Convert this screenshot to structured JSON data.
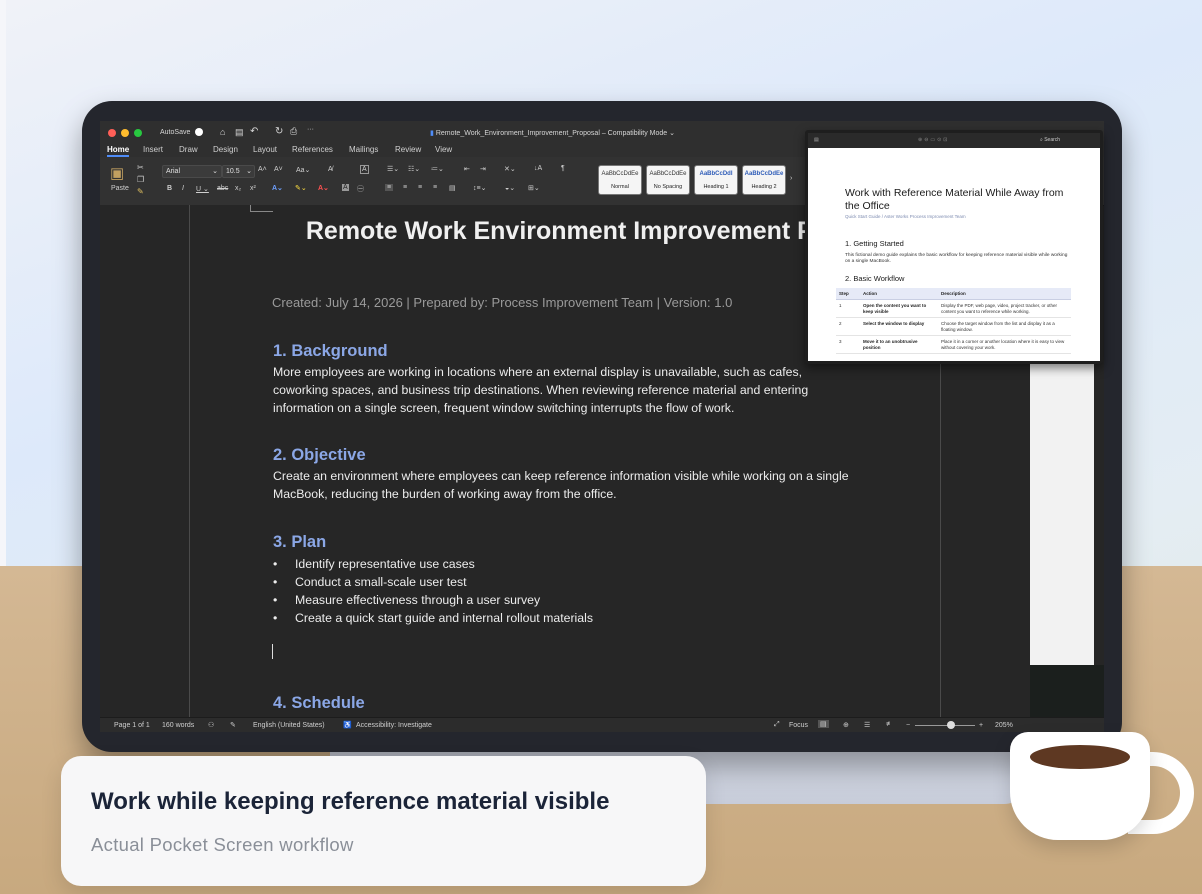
{
  "word": {
    "autosave": "AutoSave",
    "filename": "Remote_Work_Environment_Improvement_Proposal",
    "mode": "Compatibility Mode",
    "tabs": [
      "Home",
      "Insert",
      "Draw",
      "Design",
      "Layout",
      "References",
      "Mailings",
      "Review",
      "View"
    ],
    "paste_label": "Paste",
    "font_name": "Arial",
    "font_size": "10.5",
    "styles": [
      {
        "preview": "AaBbCcDdEe",
        "name": "Normal"
      },
      {
        "preview": "AaBbCcDdEe",
        "name": "No Spacing"
      },
      {
        "preview": "AaBbCcDdI",
        "name": "Heading 1"
      },
      {
        "preview": "AaBbCcDdEe",
        "name": "Heading 2"
      }
    ],
    "status": {
      "page": "Page 1 of 1",
      "words": "160 words",
      "language": "English (United States)",
      "accessibility": "Accessibility: Investigate",
      "focus": "Focus",
      "zoom": "205%"
    }
  },
  "document": {
    "title": "Remote Work Environment Improvement Proposal",
    "meta": "Created: July 14, 2026   |   Prepared by: Process Improvement Team   |   Version: 1.0",
    "sections": [
      {
        "heading": "1. Background",
        "text": "More employees are working in locations where an external display is unavailable, such as cafes, coworking spaces, and business trip destinations. When reviewing reference material and entering information on a single screen, frequent window switching interrupts the flow of work."
      },
      {
        "heading": "2. Objective",
        "text": "Create an environment where employees can keep reference information visible while working on a single MacBook, reducing the burden of working away from the office."
      },
      {
        "heading": "3. Plan",
        "bullets": [
          "Identify representative use cases",
          "Conduct a small-scale user test",
          "Measure effectiveness through a user survey",
          "Create a quick start guide and internal rollout materials"
        ]
      },
      {
        "heading": "4. Schedule"
      }
    ]
  },
  "pocket": {
    "title": "Work with Reference Material While Away from the Office",
    "subtitle": "Quick Start Guide / Aster Works Process Improvement Team",
    "h1": "1. Getting Started",
    "p1": "This fictional demo guide explains the basic workflow for keeping reference material visible while working on a single MacBook.",
    "h2": "2. Basic Workflow",
    "table_headers": [
      "Step",
      "Action",
      "Description"
    ],
    "rows": [
      [
        "1",
        "Open the content you want to keep visible",
        "Display the PDF, web page, video, project tracker, or other content you want to reference while working."
      ],
      [
        "2",
        "Select the window to display",
        "Choose the target window from the list and display it as a floating window."
      ],
      [
        "3",
        "Move it to an unobtrusive position",
        "Place it in a corner or another location where it is easy to view without covering your work."
      ]
    ],
    "search": "Search"
  },
  "caption": {
    "title": "Work while keeping reference material visible",
    "subtitle": "Actual Pocket Screen workflow"
  }
}
